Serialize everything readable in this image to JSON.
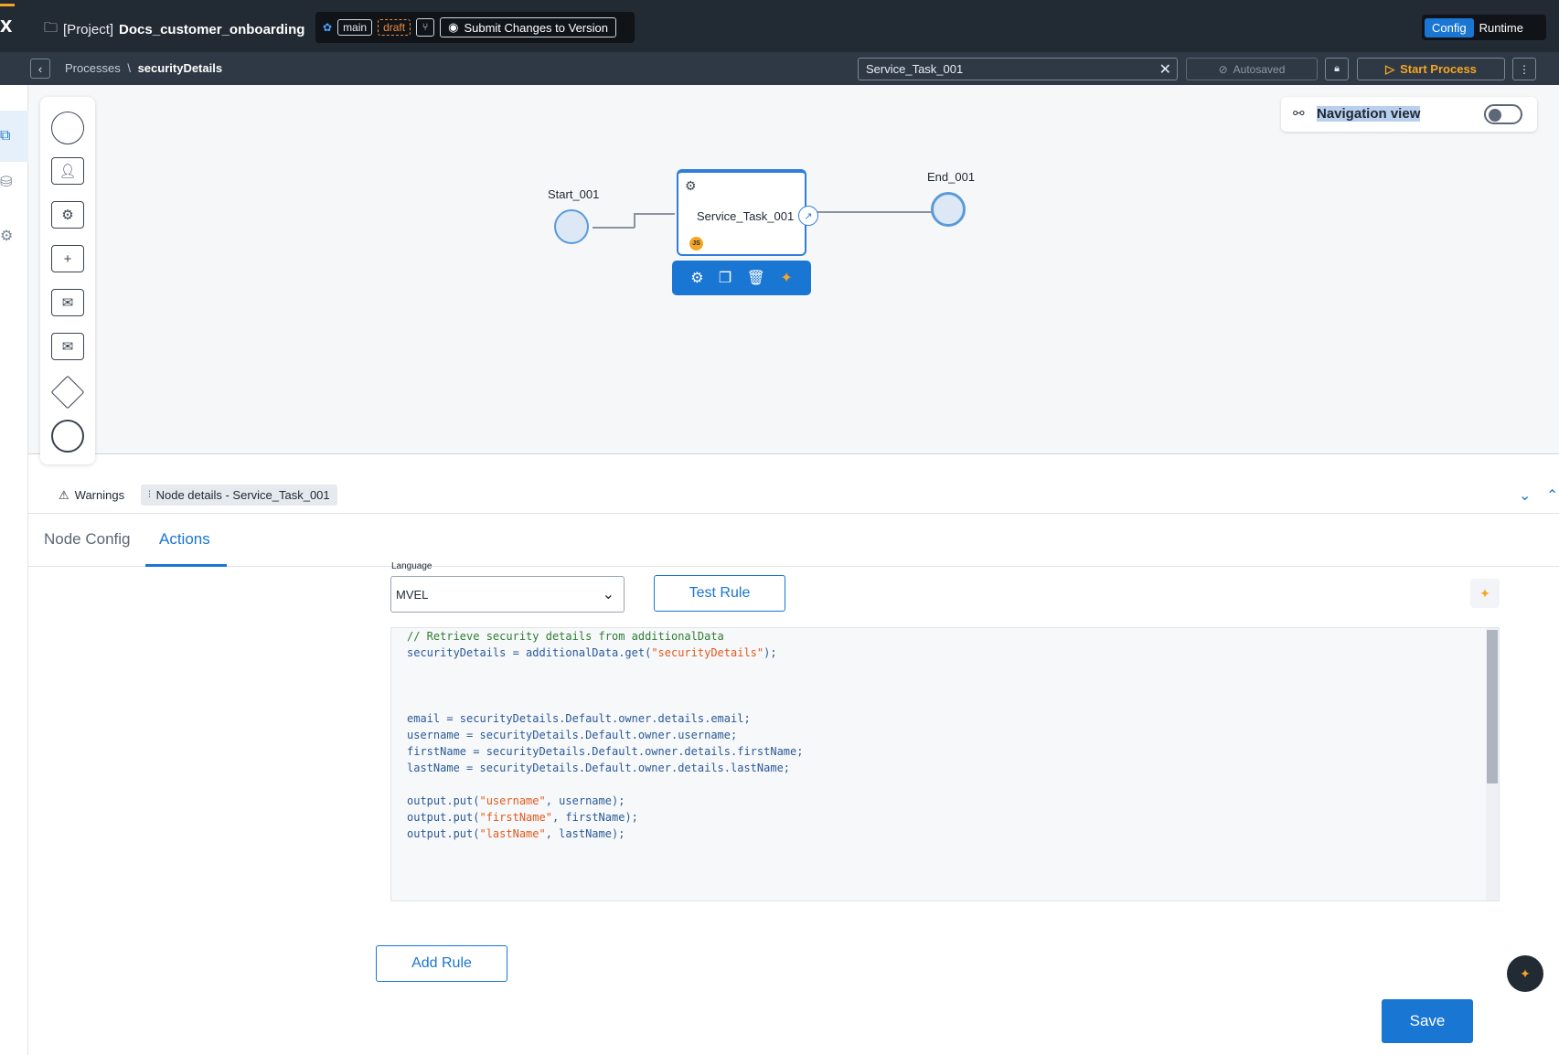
{
  "header": {
    "project_prefix": "[Project]",
    "project_name": "Docs_customer_onboarding",
    "branch": "main",
    "status": "draft",
    "submit_label": "Submit Changes to Version",
    "mode_config": "Config",
    "mode_runtime": "Runtime"
  },
  "subbar": {
    "breadcrumb_root": "Processes",
    "breadcrumb_sep": "\\",
    "breadcrumb_current": "securityDetails",
    "search_value": "Service_Task_001",
    "autosaved": "Autosaved",
    "start_process": "Start Process"
  },
  "canvas": {
    "navigation_view": "Navigation view",
    "navigation_view_on": false,
    "start_label": "Start_001",
    "task_label": "Service_Task_001",
    "end_label": "End_001",
    "task_badge": "JS"
  },
  "panel": {
    "warnings": "Warnings",
    "node_details": "Node details - Service_Task_001",
    "tabs": [
      "Node Config",
      "Actions"
    ],
    "active_tab": "Actions",
    "language_label": "Language",
    "language_value": "MVEL",
    "test_rule": "Test Rule",
    "add_rule": "Add Rule",
    "save": "Save"
  },
  "code_lines": [
    "// Retrieve security details from additionalData",
    "securityDetails = additionalData.get(\"securityDetails\");",
    "",
    "",
    "",
    "email = securityDetails.Default.owner.details.email;",
    "username = securityDetails.Default.owner.username;",
    "firstName = securityDetails.Default.owner.details.firstName;",
    "lastName = securityDetails.Default.owner.details.lastName;",
    "",
    "output.put(\"username\", username);",
    "output.put(\"firstName\", firstName);",
    "output.put(\"lastName\", lastName);"
  ],
  "colors": {
    "topbar": "#222a34",
    "accent": "#1976d2",
    "highlight": "#f5a623"
  }
}
